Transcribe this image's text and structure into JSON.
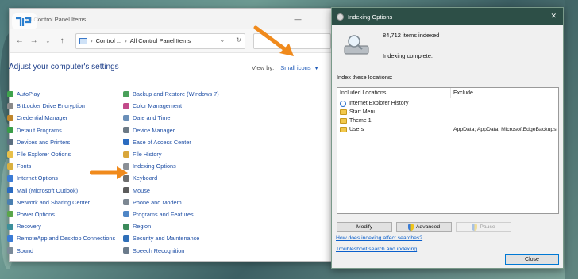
{
  "control_panel": {
    "window_title": "All Control Panel Items",
    "breadcrumb": [
      "Control ...",
      "All Control Panel Items"
    ],
    "heading": "Adjust your computer's settings",
    "view_by_label": "View by:",
    "view_by_value": "Small icons",
    "items_left": [
      {
        "label": "AutoPlay",
        "icon": "autoplay-icon",
        "color": "#3fa34d"
      },
      {
        "label": "BitLocker Drive Encryption",
        "icon": "bitlocker-icon",
        "color": "#8a8a8a"
      },
      {
        "label": "Credential Manager",
        "icon": "credential-icon",
        "color": "#c0862b"
      },
      {
        "label": "Default Programs",
        "icon": "default-programs-icon",
        "color": "#3a9d48"
      },
      {
        "label": "Devices and Printers",
        "icon": "printer-icon",
        "color": "#5b6f80"
      },
      {
        "label": "File Explorer Options",
        "icon": "folder-icon",
        "color": "#e8c04a"
      },
      {
        "label": "Fonts",
        "icon": "fonts-icon",
        "color": "#d9b040"
      },
      {
        "label": "Internet Options",
        "icon": "internet-icon",
        "color": "#3a7bd5"
      },
      {
        "label": "Mail (Microsoft Outlook)",
        "icon": "mail-icon",
        "color": "#2a6bc0"
      },
      {
        "label": "Network and Sharing Center",
        "icon": "network-icon",
        "color": "#4a7fb0"
      },
      {
        "label": "Power Options",
        "icon": "power-icon",
        "color": "#5aa64a"
      },
      {
        "label": "Recovery",
        "icon": "recovery-icon",
        "color": "#3c8f9a"
      },
      {
        "label": "RemoteApp and Desktop Connections",
        "icon": "remoteapp-icon",
        "color": "#3a7bd5"
      },
      {
        "label": "Sound",
        "icon": "sound-icon",
        "color": "#7a8a99"
      }
    ],
    "items_right": [
      {
        "label": "Backup and Restore (Windows 7)",
        "icon": "backup-icon",
        "color": "#4aa05a"
      },
      {
        "label": "Color Management",
        "icon": "color-management-icon",
        "color": "#c24a8a"
      },
      {
        "label": "Date and Time",
        "icon": "clock-icon",
        "color": "#6a8fb8"
      },
      {
        "label": "Device Manager",
        "icon": "device-manager-icon",
        "color": "#6c7a86"
      },
      {
        "label": "Ease of Access Center",
        "icon": "ease-of-access-icon",
        "color": "#2a6bc0"
      },
      {
        "label": "File History",
        "icon": "file-history-icon",
        "color": "#d9a63a"
      },
      {
        "label": "Indexing Options",
        "icon": "indexing-icon",
        "color": "#8a8f96"
      },
      {
        "label": "Keyboard",
        "icon": "keyboard-icon",
        "color": "#6e6e6e"
      },
      {
        "label": "Mouse",
        "icon": "mouse-icon",
        "color": "#5c5c5c"
      },
      {
        "label": "Phone and Modem",
        "icon": "phone-icon",
        "color": "#7c8792"
      },
      {
        "label": "Programs and Features",
        "icon": "programs-icon",
        "color": "#4f86c6"
      },
      {
        "label": "Region",
        "icon": "region-icon",
        "color": "#3a8a5a"
      },
      {
        "label": "Security and Maintenance",
        "icon": "flag-icon",
        "color": "#2f6fb8"
      },
      {
        "label": "Speech Recognition",
        "icon": "speech-icon",
        "color": "#6b7b8b"
      }
    ]
  },
  "indexing": {
    "title": "Indexing Options",
    "items_indexed": "84,712 items indexed",
    "status": "Indexing complete.",
    "index_locations_label": "Index these locations:",
    "col_included": "Included Locations",
    "col_exclude": "Exclude",
    "locations": [
      {
        "name": "Internet Explorer History",
        "icon": "ie",
        "exclude": ""
      },
      {
        "name": "Start Menu",
        "icon": "folder",
        "exclude": ""
      },
      {
        "name": "Theme 1",
        "icon": "folder",
        "exclude": ""
      },
      {
        "name": "Users",
        "icon": "folder",
        "exclude": "AppData; AppData; MicrosoftEdgeBackups"
      }
    ],
    "modify_label": "Modify",
    "advanced_label": "Advanced",
    "pause_label": "Pause",
    "link_how": "How does indexing affect searches?",
    "link_troubleshoot": "Troubleshoot search and indexing",
    "close_label": "Close"
  },
  "colors": {
    "accent_blue": "#1f4fa5",
    "arrow_orange": "#f08a1c",
    "dialog_titlebar": "#2d4f47"
  }
}
